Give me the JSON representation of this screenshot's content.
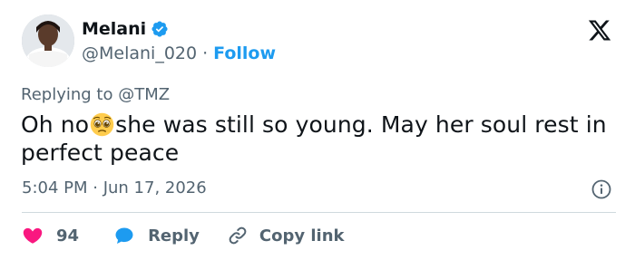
{
  "tweet": {
    "author": {
      "name": "Melani",
      "handle": "@Melani_020",
      "follow_label": "Follow",
      "separator": "·",
      "verified_icon": "verified-badge-icon",
      "avatar_icon": "avatar"
    },
    "replying_prefix": "Replying to",
    "replying_to": "@TMZ",
    "text_before_emoji": "Oh no",
    "emoji": "pleading-face-emoji",
    "text_after_emoji": "she was still so young. May her soul rest in perfect peace",
    "timestamp": "5:04 PM · Jun 17, 2026",
    "actions": {
      "likes_count": "94",
      "reply_label": "Reply",
      "copy_link_label": "Copy link"
    }
  },
  "colors": {
    "accent": "#1d9bf0",
    "like": "#f91880",
    "muted_text": "#536471",
    "primary_text": "#0f1419",
    "divider": "#cfd9de"
  }
}
